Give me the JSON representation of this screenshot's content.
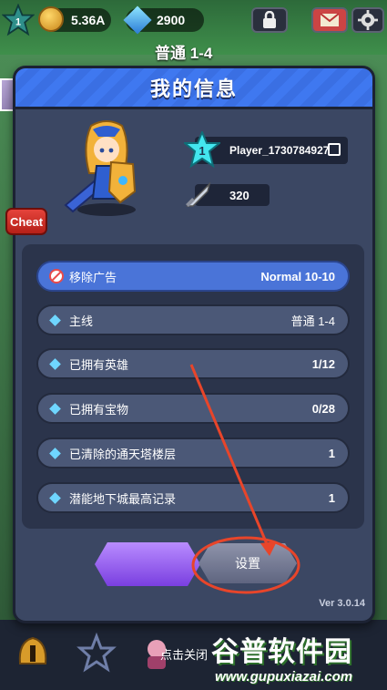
{
  "hud": {
    "level": "1",
    "gold": "5.36A",
    "gems": "2900"
  },
  "stage": {
    "title": "普通 1-4"
  },
  "panel": {
    "title": "我的信息",
    "player_level": "1",
    "player_name": "Player_1730784927",
    "power": "320",
    "cheat_label": "Cheat"
  },
  "rows": [
    {
      "label": "移除广告",
      "value": "Normal 10-10"
    },
    {
      "label": "主线",
      "value": "普通 1-4"
    },
    {
      "label": "已拥有英雄",
      "value": "1/12"
    },
    {
      "label": "已拥有宝物",
      "value": "0/28"
    },
    {
      "label": "已清除的通天塔楼层",
      "value": "1"
    },
    {
      "label": "潜能地下城最高记录",
      "value": "1"
    }
  ],
  "buttons": {
    "settings_label": "设置"
  },
  "version": "Ver 3.0.14",
  "close_hint": "点击关闭",
  "watermark": {
    "line1": "谷普软件园",
    "line2": "www.gupuxiazai.com"
  },
  "colors": {
    "header_blue": "#3f78f0",
    "panel_bg": "#3b4763",
    "row_bg": "#4b5877",
    "ad_row_bg": "#4a74d8",
    "cheat_red": "#e5433b",
    "highlight_circle": "#e8452a"
  }
}
